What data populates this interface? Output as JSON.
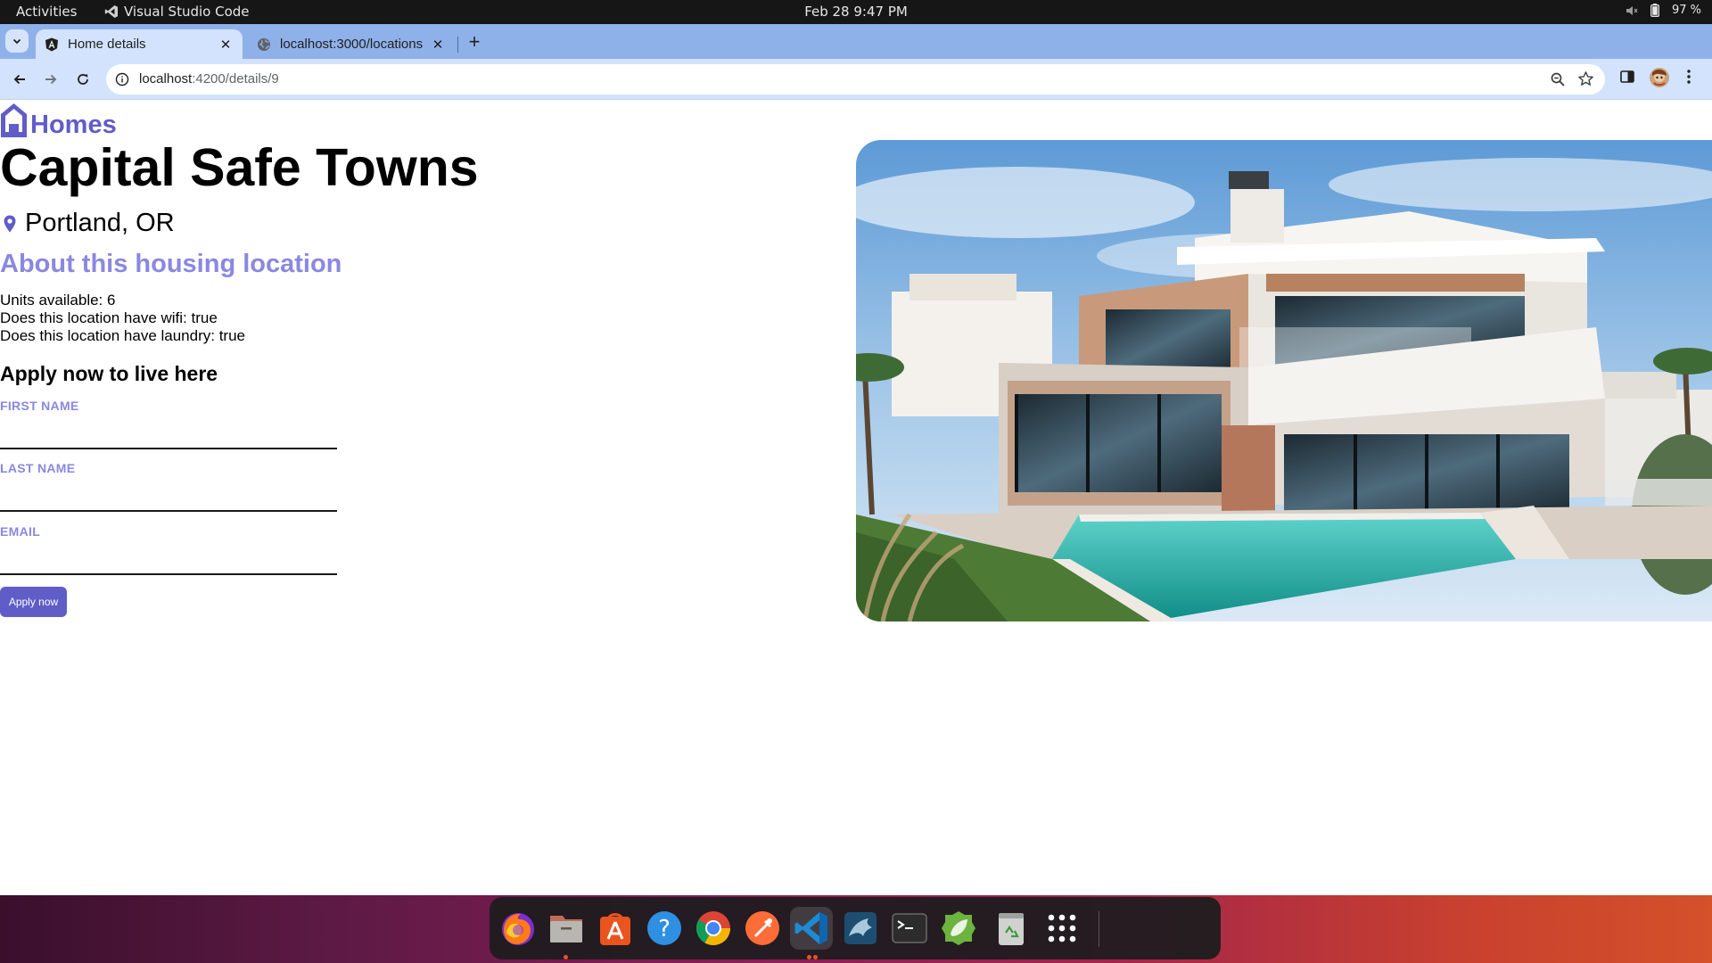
{
  "system_bar": {
    "activities": "Activities",
    "app_name": "Visual Studio Code",
    "clock": "Feb 28  9:47 PM",
    "battery": "97 %"
  },
  "browser": {
    "tabs": [
      {
        "label": "Home details",
        "active": true
      },
      {
        "label": "localhost:3000/locations",
        "active": false
      }
    ],
    "address": {
      "host": "localhost",
      "path": ":4200/details/9"
    }
  },
  "page": {
    "brand": "Homes",
    "title": "Capital Safe Towns",
    "location": "Portland, OR",
    "about_heading": "About this housing location",
    "facts": [
      "Units available: 6",
      "Does this location have wifi: true",
      "Does this location have laundry: true"
    ],
    "apply_heading": "Apply now to live here",
    "form": {
      "first_name_label": "FIRST NAME",
      "last_name_label": "LAST NAME",
      "email_label": "EMAIL",
      "submit": "Apply now"
    },
    "colors": {
      "accent": "#605dc8",
      "accent_light": "#8a88e0"
    }
  },
  "dock": {
    "items": [
      "firefox-icon",
      "files-icon",
      "app-center-icon",
      "help-icon",
      "chrome-icon",
      "postman-icon",
      "vscode-icon",
      "mysql-workbench-icon",
      "terminal-icon",
      "spring-tools-icon",
      "trash-icon",
      "show-apps-icon"
    ]
  }
}
